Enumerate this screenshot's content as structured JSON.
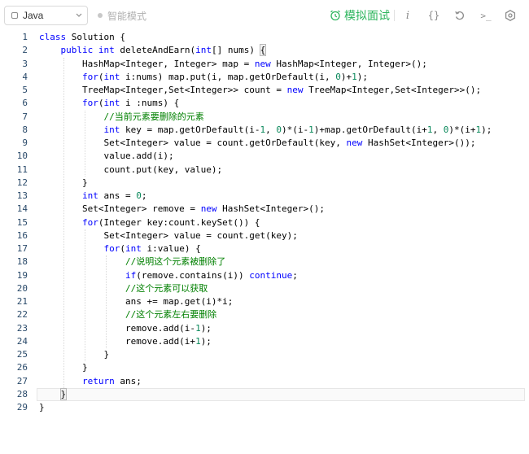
{
  "toolbar": {
    "language": "Java",
    "smart_mode_label": "智能模式",
    "mock_interview_label": "模拟面试",
    "info_icon": "i",
    "braces_icon": "{}",
    "reset_icon": "reset-icon",
    "console_icon": ">_",
    "settings_icon": "gear-icon",
    "accent_color": "#2db55d"
  },
  "editor": {
    "lines": [
      {
        "n": "1",
        "tokens": [
          [
            "kw",
            "class"
          ],
          [
            "t",
            " Solution {"
          ]
        ]
      },
      {
        "n": "2",
        "tokens": [
          [
            "t",
            "    "
          ],
          [
            "kw",
            "public"
          ],
          [
            "t",
            " "
          ],
          [
            "kw",
            "int"
          ],
          [
            "t",
            " deleteAndEarn("
          ],
          [
            "kw",
            "int"
          ],
          [
            "t",
            "[] nums) "
          ],
          [
            "hl",
            "{"
          ]
        ]
      },
      {
        "n": "3",
        "tokens": [
          [
            "t",
            "        HashMap<Integer, Integer> map = "
          ],
          [
            "kw",
            "new"
          ],
          [
            "t",
            " HashMap<Integer, Integer>();"
          ]
        ]
      },
      {
        "n": "4",
        "tokens": [
          [
            "t",
            "        "
          ],
          [
            "kw",
            "for"
          ],
          [
            "t",
            "("
          ],
          [
            "kw",
            "int"
          ],
          [
            "t",
            " i:nums) map.put(i, map.getOrDefault(i, "
          ],
          [
            "n",
            "0"
          ],
          [
            "t",
            ")+"
          ],
          [
            "n",
            "1"
          ],
          [
            "t",
            ");"
          ]
        ]
      },
      {
        "n": "5",
        "tokens": [
          [
            "t",
            "        TreeMap<Integer,Set<Integer>> count = "
          ],
          [
            "kw",
            "new"
          ],
          [
            "t",
            " TreeMap<Integer,Set<Integer>>();"
          ]
        ]
      },
      {
        "n": "6",
        "tokens": [
          [
            "t",
            "        "
          ],
          [
            "kw",
            "for"
          ],
          [
            "t",
            "("
          ],
          [
            "kw",
            "int"
          ],
          [
            "t",
            " i :nums) {"
          ]
        ]
      },
      {
        "n": "7",
        "tokens": [
          [
            "t",
            "            "
          ],
          [
            "c",
            "//当前元素要删除的元素"
          ]
        ]
      },
      {
        "n": "8",
        "tokens": [
          [
            "t",
            "            "
          ],
          [
            "kw",
            "int"
          ],
          [
            "t",
            " key = map.getOrDefault(i-"
          ],
          [
            "n",
            "1"
          ],
          [
            "t",
            ", "
          ],
          [
            "n",
            "0"
          ],
          [
            "t",
            ")*(i-"
          ],
          [
            "n",
            "1"
          ],
          [
            "t",
            ")+map.getOrDefault(i+"
          ],
          [
            "n",
            "1"
          ],
          [
            "t",
            ", "
          ],
          [
            "n",
            "0"
          ],
          [
            "t",
            ")*(i+"
          ],
          [
            "n",
            "1"
          ],
          [
            "t",
            ");"
          ]
        ]
      },
      {
        "n": "9",
        "tokens": [
          [
            "t",
            "            Set<Integer> value = count.getOrDefault(key, "
          ],
          [
            "kw",
            "new"
          ],
          [
            "t",
            " HashSet<Integer>());"
          ]
        ]
      },
      {
        "n": "10",
        "tokens": [
          [
            "t",
            "            value.add(i);"
          ]
        ]
      },
      {
        "n": "11",
        "tokens": [
          [
            "t",
            "            count.put(key, value);"
          ]
        ]
      },
      {
        "n": "12",
        "tokens": [
          [
            "t",
            "        }"
          ]
        ]
      },
      {
        "n": "13",
        "tokens": [
          [
            "t",
            "        "
          ],
          [
            "kw",
            "int"
          ],
          [
            "t",
            " ans = "
          ],
          [
            "n",
            "0"
          ],
          [
            "t",
            ";"
          ]
        ]
      },
      {
        "n": "14",
        "tokens": [
          [
            "t",
            "        Set<Integer> remove = "
          ],
          [
            "kw",
            "new"
          ],
          [
            "t",
            " HashSet<Integer>();"
          ]
        ]
      },
      {
        "n": "15",
        "tokens": [
          [
            "t",
            "        "
          ],
          [
            "kw",
            "for"
          ],
          [
            "t",
            "(Integer key:count.keySet()) {"
          ]
        ]
      },
      {
        "n": "16",
        "tokens": [
          [
            "t",
            "            Set<Integer> value = count.get(key);"
          ]
        ]
      },
      {
        "n": "17",
        "tokens": [
          [
            "t",
            "            "
          ],
          [
            "kw",
            "for"
          ],
          [
            "t",
            "("
          ],
          [
            "kw",
            "int"
          ],
          [
            "t",
            " i:value) {"
          ]
        ]
      },
      {
        "n": "18",
        "tokens": [
          [
            "t",
            "                "
          ],
          [
            "c",
            "//说明这个元素被删除了"
          ]
        ]
      },
      {
        "n": "19",
        "tokens": [
          [
            "t",
            "                "
          ],
          [
            "kw",
            "if"
          ],
          [
            "t",
            "(remove.contains(i)) "
          ],
          [
            "kw",
            "continue"
          ],
          [
            "t",
            ";"
          ]
        ]
      },
      {
        "n": "20",
        "tokens": [
          [
            "t",
            "                "
          ],
          [
            "c",
            "//这个元素可以获取"
          ]
        ]
      },
      {
        "n": "21",
        "tokens": [
          [
            "t",
            "                ans += map.get(i)*i;"
          ]
        ]
      },
      {
        "n": "22",
        "tokens": [
          [
            "t",
            "                "
          ],
          [
            "c",
            "//这个元素左右要删除"
          ]
        ]
      },
      {
        "n": "23",
        "tokens": [
          [
            "t",
            "                remove.add(i-"
          ],
          [
            "n",
            "1"
          ],
          [
            "t",
            ");"
          ]
        ]
      },
      {
        "n": "24",
        "tokens": [
          [
            "t",
            "                remove.add(i+"
          ],
          [
            "n",
            "1"
          ],
          [
            "t",
            ");"
          ]
        ]
      },
      {
        "n": "25",
        "tokens": [
          [
            "t",
            "            }"
          ]
        ]
      },
      {
        "n": "26",
        "tokens": [
          [
            "t",
            "        }"
          ]
        ]
      },
      {
        "n": "27",
        "tokens": [
          [
            "t",
            "        "
          ],
          [
            "kw",
            "return"
          ],
          [
            "t",
            " ans;"
          ]
        ]
      },
      {
        "n": "28",
        "tokens": [
          [
            "t",
            "    "
          ],
          [
            "hl",
            "}"
          ]
        ]
      },
      {
        "n": "29",
        "tokens": [
          [
            "t",
            "}"
          ]
        ]
      }
    ],
    "active_line": "28"
  }
}
